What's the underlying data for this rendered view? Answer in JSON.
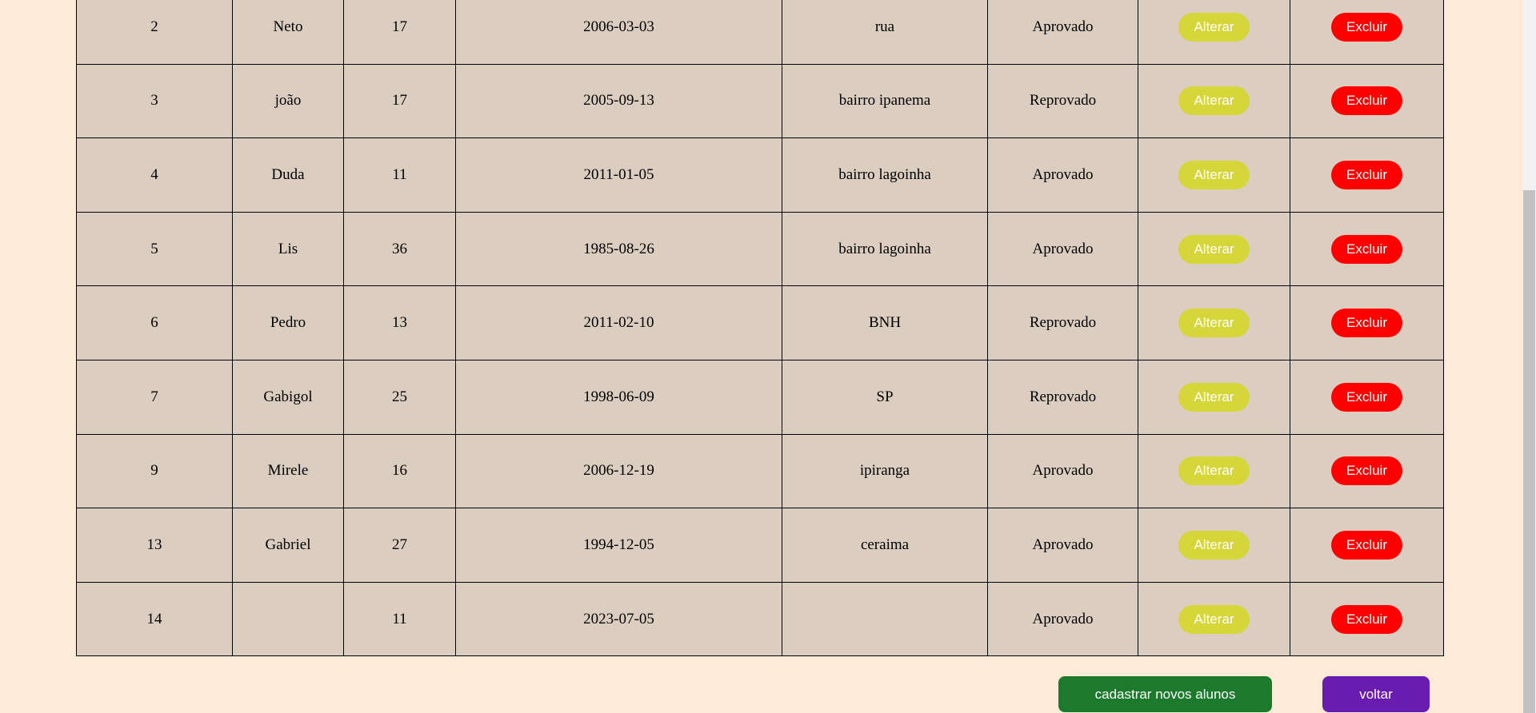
{
  "table": {
    "rows": [
      {
        "id": "2",
        "nome": "Neto",
        "idade": "17",
        "data": "2006-03-03",
        "endereco": "rua",
        "status": "Aprovado"
      },
      {
        "id": "3",
        "nome": "joão",
        "idade": "17",
        "data": "2005-09-13",
        "endereco": "bairro ipanema",
        "status": "Reprovado"
      },
      {
        "id": "4",
        "nome": "Duda",
        "idade": "11",
        "data": "2011-01-05",
        "endereco": "bairro lagoinha",
        "status": "Aprovado"
      },
      {
        "id": "5",
        "nome": "Lis",
        "idade": "36",
        "data": "1985-08-26",
        "endereco": "bairro lagoinha",
        "status": "Aprovado"
      },
      {
        "id": "6",
        "nome": "Pedro",
        "idade": "13",
        "data": "2011-02-10",
        "endereco": "BNH",
        "status": "Reprovado"
      },
      {
        "id": "7",
        "nome": "Gabigol",
        "idade": "25",
        "data": "1998-06-09",
        "endereco": "SP",
        "status": "Reprovado"
      },
      {
        "id": "9",
        "nome": "Mirele",
        "idade": "16",
        "data": "2006-12-19",
        "endereco": "ipiranga",
        "status": "Aprovado"
      },
      {
        "id": "13",
        "nome": "Gabriel",
        "idade": "27",
        "data": "1994-12-05",
        "endereco": "ceraima",
        "status": "Aprovado"
      },
      {
        "id": "14",
        "nome": "",
        "idade": "11",
        "data": "2023-07-05",
        "endereco": "",
        "status": "Aprovado"
      }
    ],
    "alter_label": "Alterar",
    "delete_label": "Excluir"
  },
  "footer": {
    "register_label": "cadastrar novos alunos",
    "back_label": "voltar"
  },
  "colors": {
    "page_background": "#fbebd7",
    "table_background": "#dbcdbf",
    "alter_button": "#d6d63a",
    "delete_button": "#ff0000",
    "register_button": "#1b7a2b",
    "back_button": "#6a1bb0"
  }
}
